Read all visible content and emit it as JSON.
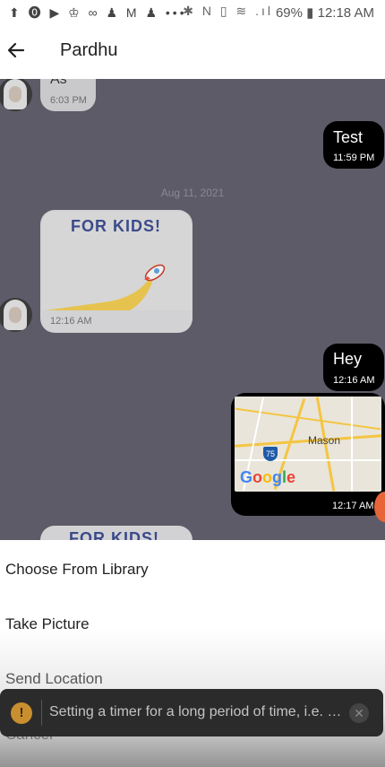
{
  "statusbar": {
    "notif_icons": "⬆ ⓿ ▶ ♔ ∞ ♟ M ♟ •••",
    "sys_icons": "✱ N ▯ ≋ .ıl",
    "battery": "69%",
    "time": "12:18 AM"
  },
  "header": {
    "title": "Pardhu"
  },
  "chat": {
    "msg1": {
      "text": "As",
      "time": "6:03 PM"
    },
    "msg2": {
      "text": "Test",
      "time": "11:59 PM"
    },
    "date_separator": "Aug 11, 2021",
    "img_msg": {
      "caption": "FOR KIDS!",
      "time": "12:16 AM"
    },
    "msg3": {
      "text": "Hey",
      "time": "12:16 AM"
    },
    "map_msg": {
      "place": "Mason",
      "route": "75",
      "brand": "Google",
      "time": "12:17 AM"
    },
    "partial_img": {
      "caption": "FOR KIDS!"
    }
  },
  "sheet": {
    "items": [
      "Choose From Library",
      "Take Picture",
      "Send Location",
      "Cancel"
    ]
  },
  "toast": {
    "message": "Setting a timer for a long period of time, i.e. m...",
    "icon": "!"
  },
  "colors": {
    "chat_bg": "#5d5b67",
    "bubble_out": "#000000",
    "bubble_in": "#c9c9cc"
  }
}
